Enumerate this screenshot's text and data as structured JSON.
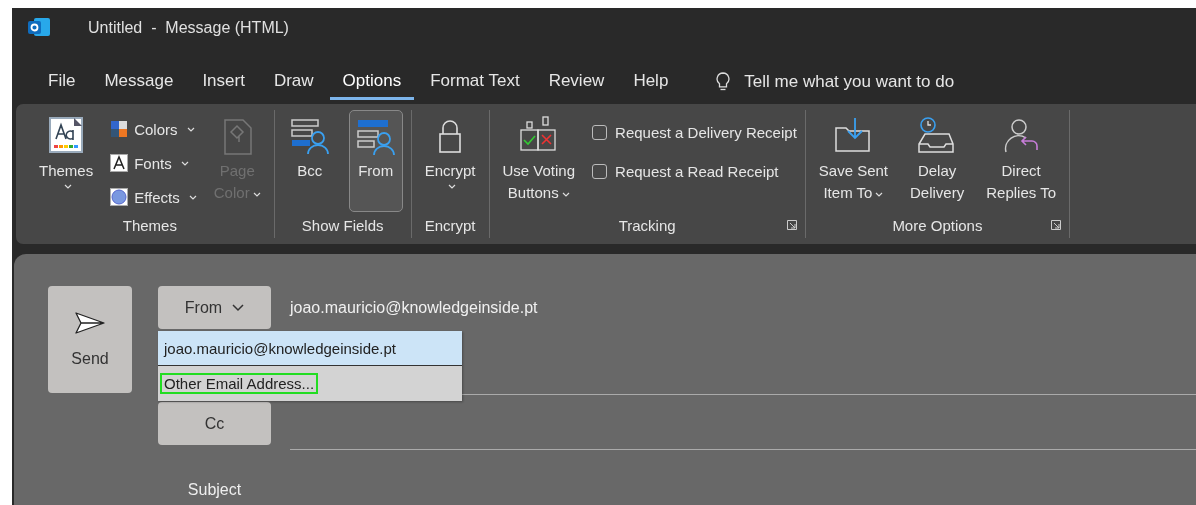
{
  "window": {
    "title": "Untitled  -  Message (HTML)"
  },
  "tabs": [
    {
      "label": "File",
      "selected": false
    },
    {
      "label": "Message",
      "selected": false
    },
    {
      "label": "Insert",
      "selected": false
    },
    {
      "label": "Draw",
      "selected": false
    },
    {
      "label": "Options",
      "selected": true
    },
    {
      "label": "Format Text",
      "selected": false
    },
    {
      "label": "Review",
      "selected": false
    },
    {
      "label": "Help",
      "selected": false
    }
  ],
  "tell_me": {
    "placeholder": "Tell me what you want to do"
  },
  "ribbon": {
    "groups": [
      {
        "label": "Themes",
        "launcher": false,
        "items": [
          {
            "kind": "large",
            "lines": [
              "Themes"
            ],
            "dropdown": true,
            "disabled": false,
            "selected": false
          },
          {
            "kind": "small_stack",
            "entries": [
              {
                "label": "Colors",
                "dropdown": true
              },
              {
                "label": "Fonts",
                "dropdown": true
              },
              {
                "label": "Effects",
                "dropdown": true
              }
            ]
          },
          {
            "kind": "large",
            "lines": [
              "Page",
              "Color"
            ],
            "dropdown": true,
            "disabled": true,
            "selected": false
          }
        ]
      },
      {
        "label": "Show Fields",
        "launcher": false,
        "items": [
          {
            "kind": "large",
            "lines": [
              "Bcc"
            ],
            "dropdown": false,
            "disabled": false,
            "selected": false
          },
          {
            "kind": "large",
            "lines": [
              "From"
            ],
            "dropdown": false,
            "disabled": false,
            "selected": true
          }
        ]
      },
      {
        "label": "Encrypt",
        "launcher": false,
        "items": [
          {
            "kind": "large",
            "lines": [
              "Encrypt"
            ],
            "dropdown": true,
            "disabled": false,
            "selected": false
          }
        ]
      },
      {
        "label": "Tracking",
        "launcher": true,
        "items": [
          {
            "kind": "large",
            "lines": [
              "Use Voting",
              "Buttons"
            ],
            "dropdown": true,
            "disabled": false,
            "selected": false
          },
          {
            "kind": "checks",
            "entries": [
              {
                "label": "Request a Delivery Receipt",
                "checked": false
              },
              {
                "label": "Request a Read Receipt",
                "checked": false
              }
            ]
          }
        ]
      },
      {
        "label": "More Options",
        "launcher": true,
        "items": [
          {
            "kind": "large",
            "lines": [
              "Save Sent",
              "Item To"
            ],
            "dropdown": true,
            "disabled": false,
            "selected": false
          },
          {
            "kind": "large",
            "lines": [
              "Delay",
              "Delivery"
            ],
            "dropdown": false,
            "disabled": false,
            "selected": false
          },
          {
            "kind": "large",
            "lines": [
              "Direct",
              "Replies To"
            ],
            "dropdown": false,
            "disabled": false,
            "selected": false
          }
        ]
      }
    ]
  },
  "compose": {
    "send": "Send",
    "from_button": "From",
    "from_value": "joao.mauricio@knowledgeinside.pt",
    "cc_button": "Cc",
    "subject_label": "Subject",
    "from_menu": [
      {
        "label": "joao.mauricio@knowledgeinside.pt",
        "selected": true,
        "focused": false
      },
      {
        "label": "Other Email Address...",
        "selected": false,
        "focused": true
      }
    ]
  }
}
